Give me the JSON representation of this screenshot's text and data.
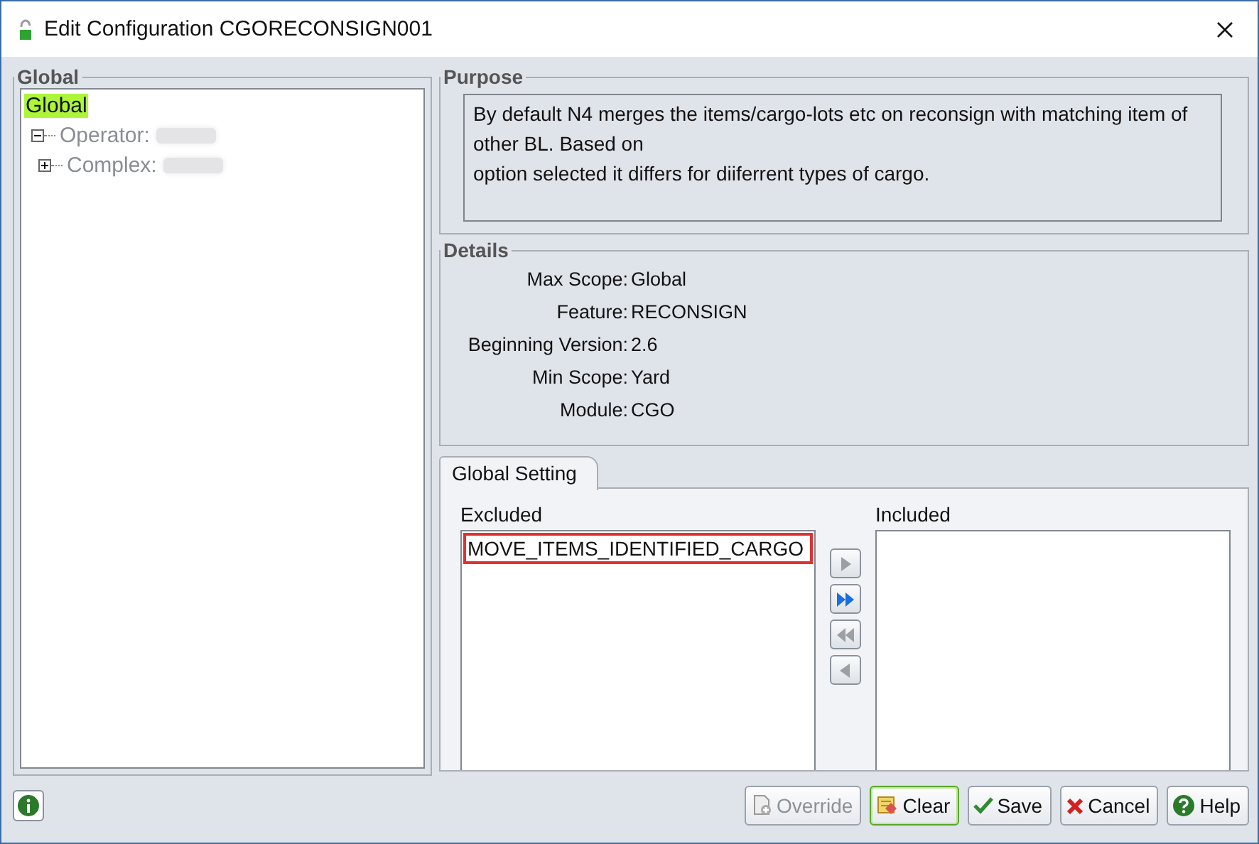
{
  "window": {
    "title": "Edit Configuration CGORECONSIGN001"
  },
  "scope_panel": {
    "legend": "Global",
    "tree": [
      {
        "label": "Global",
        "selected": true,
        "redacted": false,
        "children": [
          {
            "label": "Operator:",
            "selected": false,
            "redacted": true,
            "expanded": true,
            "children": [
              {
                "label": "Complex:",
                "selected": false,
                "redacted": true,
                "expanded": false
              }
            ]
          }
        ]
      }
    ]
  },
  "purpose": {
    "legend": "Purpose",
    "lines": [
      "By default N4 merges the items/cargo-lots etc on reconsign with matching item of other BL. Based on",
      "option selected it differs for diiferrent types of cargo."
    ]
  },
  "details": {
    "legend": "Details",
    "fields": [
      {
        "label": "Max Scope:",
        "value": "Global"
      },
      {
        "label": "Feature:",
        "value": "RECONSIGN"
      },
      {
        "label": "Beginning Version:",
        "value": "2.6"
      },
      {
        "label": "Min Scope:",
        "value": "Yard"
      },
      {
        "label": "Module:",
        "value": "CGO"
      }
    ]
  },
  "tabs": [
    {
      "label": "Global Setting",
      "selected": true
    }
  ],
  "excluded": {
    "label": "Excluded",
    "items": [
      {
        "text": "MOVE_ITEMS_IDENTIFIED_CARGO",
        "highlighted": true
      }
    ]
  },
  "transfer_buttons": [
    {
      "kind": "move-right",
      "disabled": true
    },
    {
      "kind": "move-all-right",
      "disabled": false
    },
    {
      "kind": "move-all-left",
      "disabled": true
    },
    {
      "kind": "move-left",
      "disabled": true
    }
  ],
  "included": {
    "label": "Included"
  },
  "buttons": [
    {
      "kind": "override",
      "label": "Override",
      "disabled": true,
      "focused": false
    },
    {
      "kind": "clear",
      "label": "Clear",
      "disabled": false,
      "focused": true
    },
    {
      "kind": "save",
      "label": "Save",
      "disabled": false,
      "focused": false
    },
    {
      "kind": "cancel",
      "label": "Cancel",
      "disabled": false,
      "focused": false
    },
    {
      "kind": "help",
      "label": "Help",
      "disabled": false,
      "focused": false
    }
  ]
}
